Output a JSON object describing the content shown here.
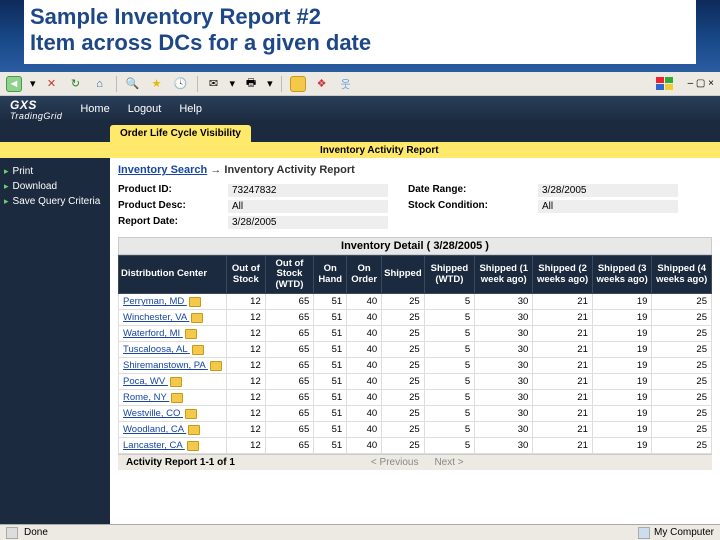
{
  "slide": {
    "title_line1": "Sample Inventory Report #2",
    "title_line2": "Item across DCs for a given date"
  },
  "appbar": {
    "brand": "GXS",
    "brand_sub": "TradingGrid",
    "home": "Home",
    "logout": "Logout",
    "help": "Help"
  },
  "tabs": {
    "active": "Order Life Cycle Visibility"
  },
  "subheader": {
    "right": "Inventory Activity Report"
  },
  "sidebar": {
    "items": [
      "Print",
      "Download",
      "Save Query Criteria"
    ]
  },
  "breadcrumb": {
    "link": "Inventory Search",
    "arrow": "→",
    "current": "Inventory Activity Report"
  },
  "filters": {
    "product_id_lbl": "Product ID:",
    "product_id": "73247832",
    "date_range_lbl": "Date Range:",
    "date_range": "3/28/2005",
    "product_desc_lbl": "Product Desc:",
    "product_desc": "All",
    "stock_cond_lbl": "Stock Condition:",
    "stock_cond": "All",
    "report_date_lbl": "Report Date:",
    "report_date": "3/28/2005"
  },
  "detail_title": "Inventory Detail ( 3/28/2005 )",
  "columns": [
    "Distribution Center",
    "Out of Stock",
    "Out of Stock (WTD)",
    "On Hand",
    "On Order",
    "Shipped",
    "Shipped (WTD)",
    "Shipped (1 week ago)",
    "Shipped (2 weeks ago)",
    "Shipped (3 weeks ago)",
    "Shipped (4 weeks ago)"
  ],
  "rows": [
    {
      "dc": "Perryman, MD",
      "v": [
        12,
        65,
        51,
        40,
        25,
        5,
        30,
        21,
        19,
        25
      ]
    },
    {
      "dc": "Winchester, VA",
      "v": [
        12,
        65,
        51,
        40,
        25,
        5,
        30,
        21,
        19,
        25
      ]
    },
    {
      "dc": "Waterford, MI",
      "v": [
        12,
        65,
        51,
        40,
        25,
        5,
        30,
        21,
        19,
        25
      ]
    },
    {
      "dc": "Tuscaloosa, AL",
      "v": [
        12,
        65,
        51,
        40,
        25,
        5,
        30,
        21,
        19,
        25
      ]
    },
    {
      "dc": "Shiremanstown, PA",
      "v": [
        12,
        65,
        51,
        40,
        25,
        5,
        30,
        21,
        19,
        25
      ]
    },
    {
      "dc": "Poca, WV",
      "v": [
        12,
        65,
        51,
        40,
        25,
        5,
        30,
        21,
        19,
        25
      ]
    },
    {
      "dc": "Rome, NY",
      "v": [
        12,
        65,
        51,
        40,
        25,
        5,
        30,
        21,
        19,
        25
      ]
    },
    {
      "dc": "Westville, CO",
      "v": [
        12,
        65,
        51,
        40,
        25,
        5,
        30,
        21,
        19,
        25
      ]
    },
    {
      "dc": "Woodland, CA",
      "v": [
        12,
        65,
        51,
        40,
        25,
        5,
        30,
        21,
        19,
        25
      ]
    },
    {
      "dc": "Lancaster, CA",
      "v": [
        12,
        65,
        51,
        40,
        25,
        5,
        30,
        21,
        19,
        25
      ]
    }
  ],
  "pager": {
    "summary": "Activity Report 1-1 of 1",
    "prev": "< Previous",
    "next": "Next >"
  },
  "status": {
    "left": "Done",
    "right": "My Computer"
  }
}
